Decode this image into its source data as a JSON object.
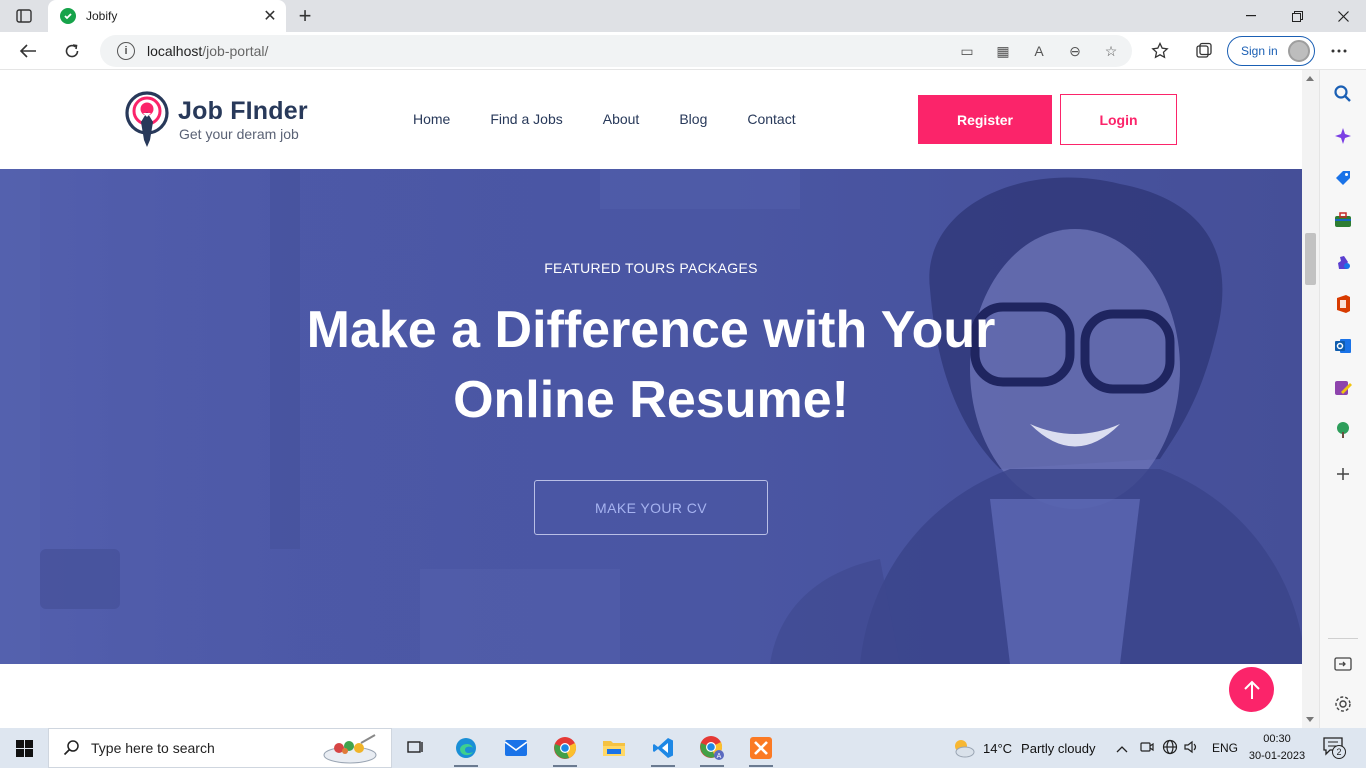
{
  "browser": {
    "tab_title": "Jobify",
    "url_host": "localhost",
    "url_path": "/job-portal/",
    "signin_label": "Sign in"
  },
  "site": {
    "logo_title": "Job FInder",
    "logo_tagline": "Get your deram job",
    "nav": [
      "Home",
      "Find a Jobs",
      "About",
      "Blog",
      "Contact"
    ],
    "register_label": "Register",
    "login_label": "Login"
  },
  "hero": {
    "subtitle": "FEATURED TOURS PACKAGES",
    "title_line1": "Make a Difference with Your",
    "title_line2": "Online Resume!",
    "cta_label": "MAKE YOUR CV"
  },
  "taskbar": {
    "search_placeholder": "Type here to search",
    "weather_temp": "14°C",
    "weather_desc": "Partly cloudy",
    "language": "ENG",
    "time": "00:30",
    "date": "30-01-2023",
    "notification_count": "2"
  },
  "colors": {
    "accent": "#fb246a",
    "brand_dark": "#28395a",
    "hero_overlay": "#4b57a6"
  }
}
